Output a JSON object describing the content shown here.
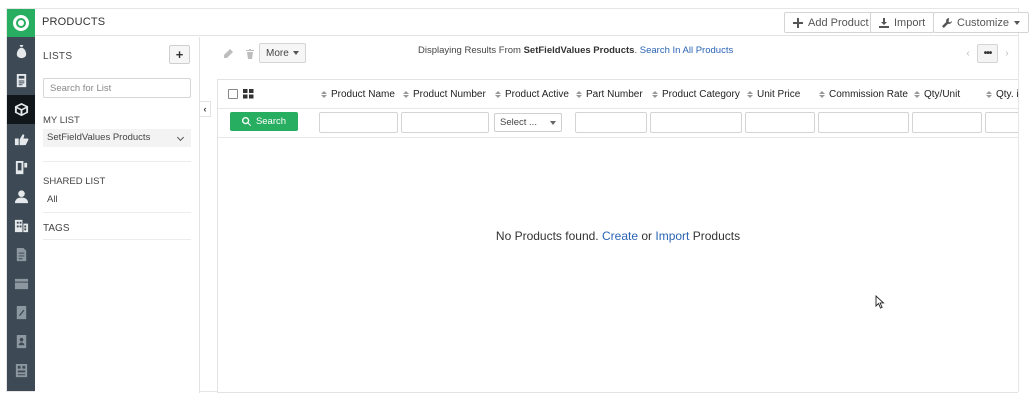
{
  "app": {
    "accent": "#27ae60",
    "rail_color": "#3d4a55",
    "link_color": "#2a64b4"
  },
  "header": {
    "title": "PRODUCTS",
    "add_product_label": "Add Product",
    "import_label": "Import",
    "customize_label": "Customize"
  },
  "rail": {
    "icons": [
      "app-logo-icon",
      "money-bag-icon",
      "id-card-icon",
      "products-icon",
      "deals-icon",
      "phone-icon",
      "contact-icon",
      "company-icon",
      "document-icon",
      "wallet-icon",
      "file-icon",
      "address-book-icon",
      "report-icon"
    ],
    "active": "products-icon"
  },
  "lists": {
    "title": "LISTS",
    "add_symbol": "+",
    "search_placeholder": "Search for List",
    "my_list_label": "MY LIST",
    "my_list_item": "SetFieldValues Products",
    "shared_list_label": "SHARED LIST",
    "shared_list_item": "All",
    "tags_label": "TAGS"
  },
  "toolbar": {
    "more_label": "More",
    "results_prefix": "Displaying Results From",
    "results_list": "SetFieldValues Products",
    "results_suffix": ".",
    "search_all_link": "Search In All Products",
    "pager_dots": "•••"
  },
  "grid": {
    "columns": [
      "Product Name",
      "Product Number",
      "Product Active",
      "Part Number",
      "Product Category",
      "Unit Price",
      "Commission Rate",
      "Qty/Unit",
      "Qty. in"
    ],
    "search_button": "Search",
    "select_placeholder": "Select ..."
  },
  "empty": {
    "prefix": "No Products found.",
    "create_link": "Create",
    "middle": "or",
    "import_link": "Import",
    "suffix": "Products"
  }
}
